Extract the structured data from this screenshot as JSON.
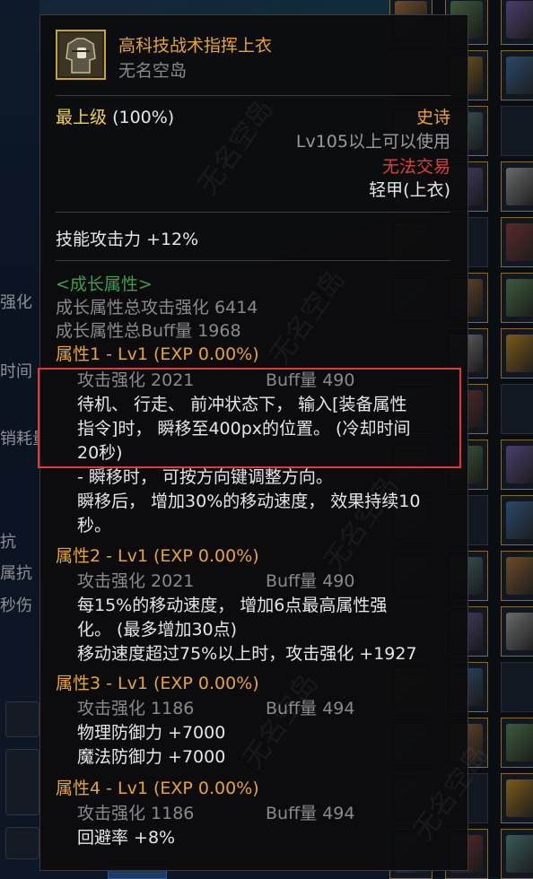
{
  "background": {
    "left_labels": [
      "强化",
      "时间",
      "销耗量",
      "抗",
      "属抗",
      "秒伤"
    ]
  },
  "tooltip": {
    "item_name": "高科技战术指挥上衣",
    "subtitle": "无名空岛",
    "grade_label": "最上级",
    "grade_value": "(100%)",
    "rarity": "史诗",
    "level_req": "Lv105以上可以使用",
    "trade": "无法交易",
    "equip_type": "轻甲(上衣)",
    "skill_attack": "技能攻击力  +12%",
    "growth": {
      "header": "<成长属性>",
      "total_attack": "成长属性总攻击强化 6414",
      "total_buff": "成长属性总Buff量 1968"
    },
    "attributes": [
      {
        "header": "属性1 - Lv1 (EXP 0.00%)",
        "atk_label": "攻击强化  2021",
        "buff_label": "Buff量  490",
        "lines": [
          "待机、 行走、 前冲状态下， 输入[装备属性",
          "指令]时， 瞬移至400px的位置。 (冷却时间",
          "20秒)",
          "- 瞬移时， 可按方向键调整方向。",
          "瞬移后， 增加30%的移动速度， 效果持续10",
          "秒。"
        ]
      },
      {
        "header": "属性2 - Lv1 (EXP 0.00%)",
        "atk_label": "攻击强化  2021",
        "buff_label": "Buff量  490",
        "lines": [
          "每15%的移动速度， 增加6点最高属性强",
          "化。 (最多增加30点)",
          "移动速度超过75%以上时，攻击强化 +1927"
        ]
      },
      {
        "header": "属性3 - Lv1 (EXP 0.00%)",
        "atk_label": "攻击强化  1186",
        "buff_label": "Buff量  494",
        "lines": [
          "物理防御力 +7000",
          "魔法防御力 +7000"
        ]
      },
      {
        "header": "属性4 - Lv1 (EXP 0.00%)",
        "atk_label": "攻击强化  1186",
        "buff_label": "Buff量  494",
        "lines": [
          "回避率 +8%"
        ]
      }
    ]
  },
  "watermark": "无名空岛",
  "colors": {
    "title": "#e5a43a",
    "grade_gold": "#f2d34a",
    "trade_red": "#d4443a",
    "growth_green": "#3aa14a",
    "highlight_box": "#e5383b"
  }
}
